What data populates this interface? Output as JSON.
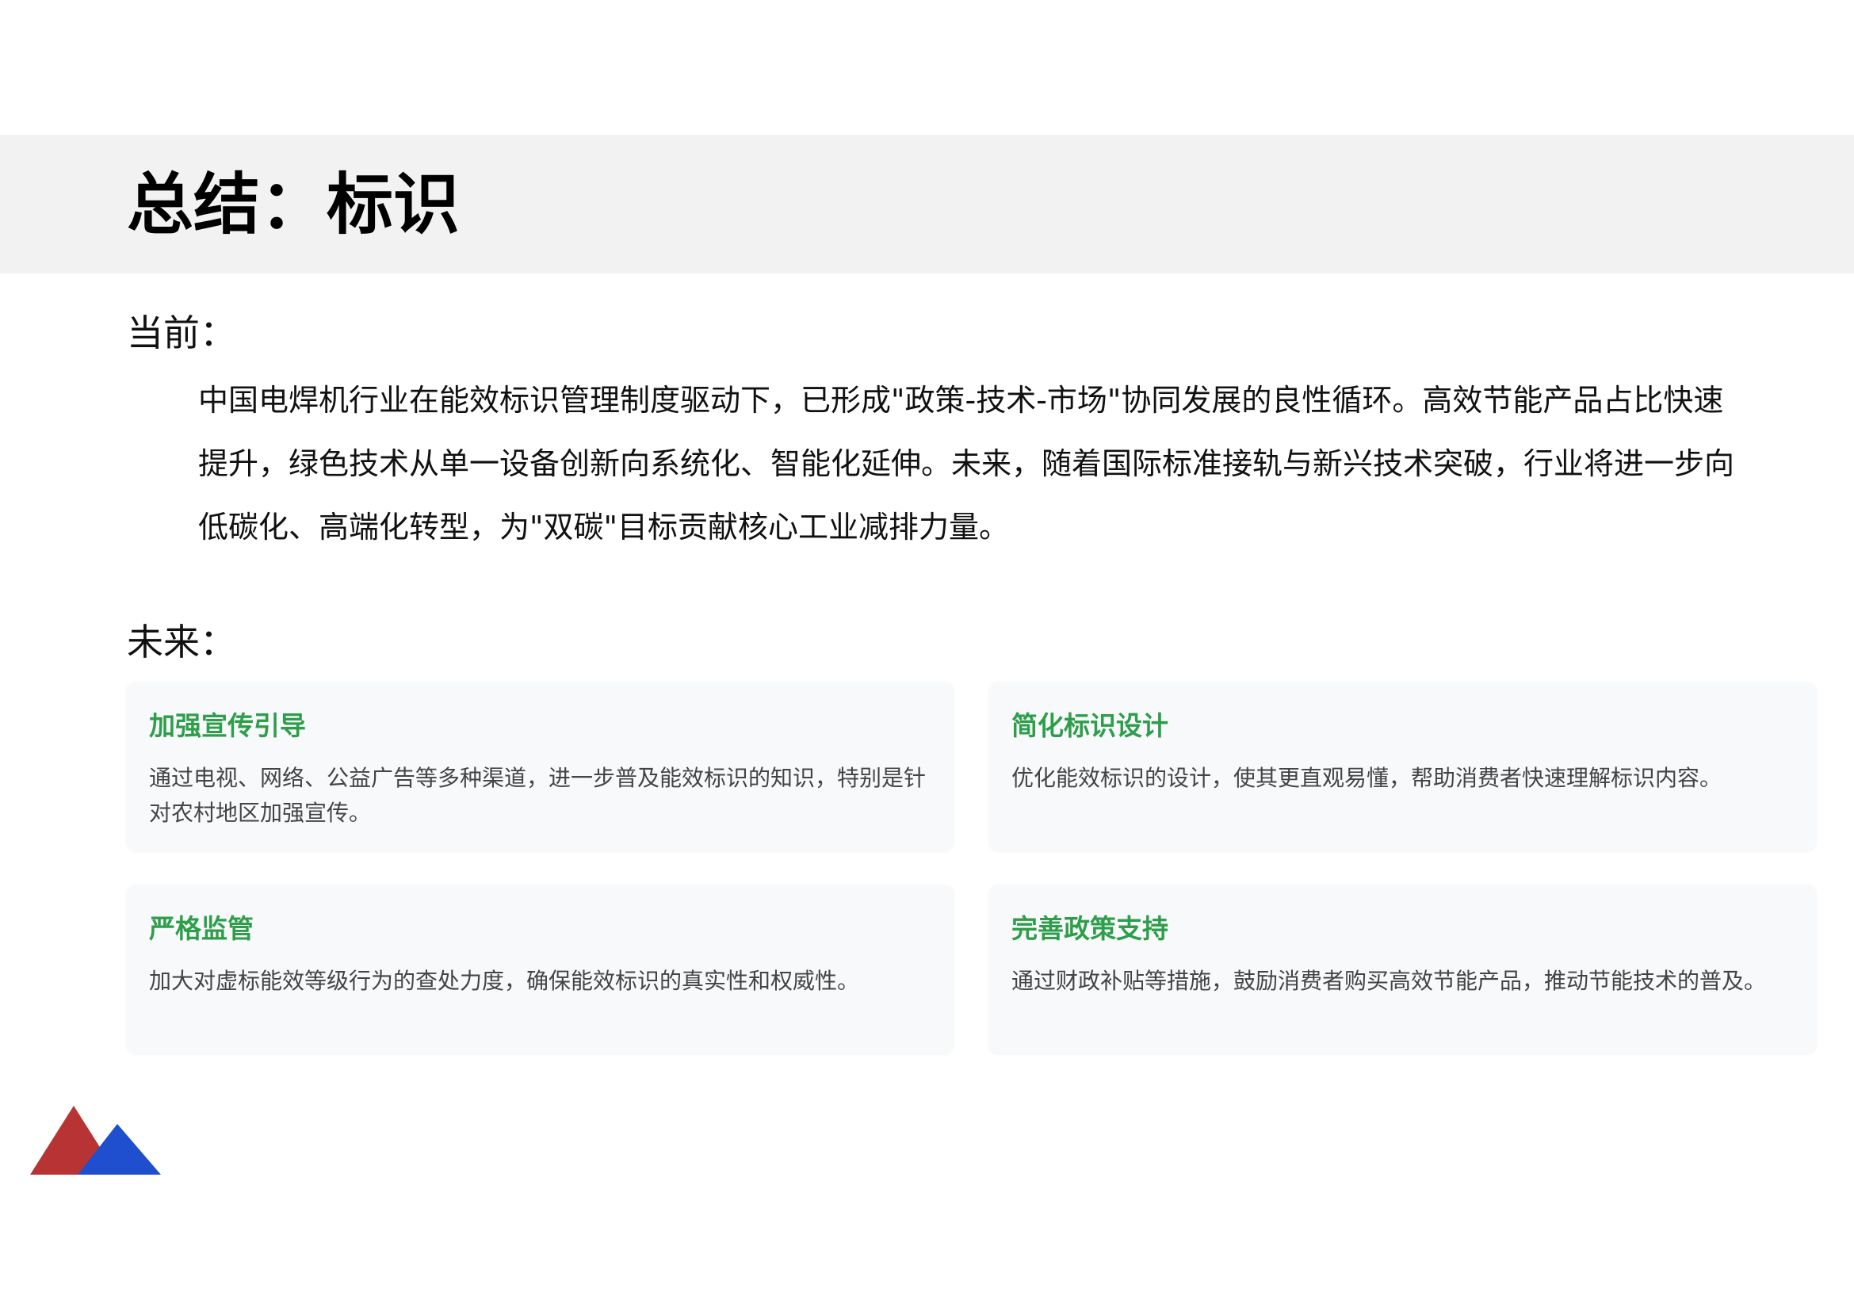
{
  "header": {
    "title": "总结：标识"
  },
  "current": {
    "label": "当前：",
    "text": "中国电焊机行业在能效标识管理制度驱动下，已形成\"政策-技术-市场\"协同发展的良性循环。高效节能产品占比快速提升，绿色技术从单一设备创新向系统化、智能化延伸。未来，随着国际标准接轨与新兴技术突破，行业将进一步向低碳化、高端化转型，为\"双碳\"目标贡献核心工业减排力量。"
  },
  "future": {
    "label": "未来：",
    "cards": [
      {
        "title": "加强宣传引导",
        "body": "通过电视、网络、公益广告等多种渠道，进一步普及能效标识的知识，特别是针对农村地区加强宣传。"
      },
      {
        "title": "简化标识设计",
        "body": "优化能效标识的设计，使其更直观易懂，帮助消费者快速理解标识内容。"
      },
      {
        "title": "严格监管",
        "body": "加大对虚标能效等级行为的查处力度，确保能效标识的真实性和权威性。"
      },
      {
        "title": "完善政策支持",
        "body": "通过财政补贴等措施，鼓励消费者购买高效节能产品，推动节能技术的普及。"
      }
    ]
  },
  "colors": {
    "title_band": "#f2f2f2",
    "card_title": "#2e9e4a",
    "card_background": "#f7f9fb",
    "logo_red": "#b83434",
    "logo_blue": "#1f4fcf"
  },
  "logo": {
    "icon": "mountain-logo-icon"
  }
}
